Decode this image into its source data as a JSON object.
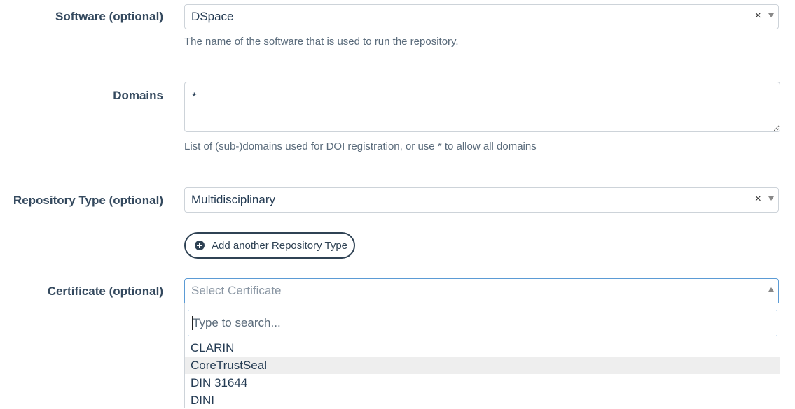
{
  "software": {
    "label": "Software (optional)",
    "value": "DSpace",
    "clear": "×",
    "help": "The name of the software that is used to run the repository."
  },
  "domains": {
    "label": "Domains",
    "value": "*",
    "help": "List of (sub-)domains used for DOI registration, or use * to allow all domains"
  },
  "repository_type": {
    "label": "Repository Type (optional)",
    "value": "Multidisciplinary",
    "clear": "×",
    "add_button": "Add another Repository Type"
  },
  "certificate": {
    "label": "Certificate (optional)",
    "placeholder": "Select Certificate",
    "search_placeholder": "Type to search...",
    "options": [
      "CLARIN",
      "CoreTrustSeal",
      "DIN 31644",
      "DINI"
    ],
    "highlighted_option": "CoreTrustSeal"
  },
  "colors": {
    "focus_border": "#5b9bd5",
    "button_border": "#2f4254",
    "label_text": "#34495e",
    "highlight_bg": "#eeeeee"
  }
}
